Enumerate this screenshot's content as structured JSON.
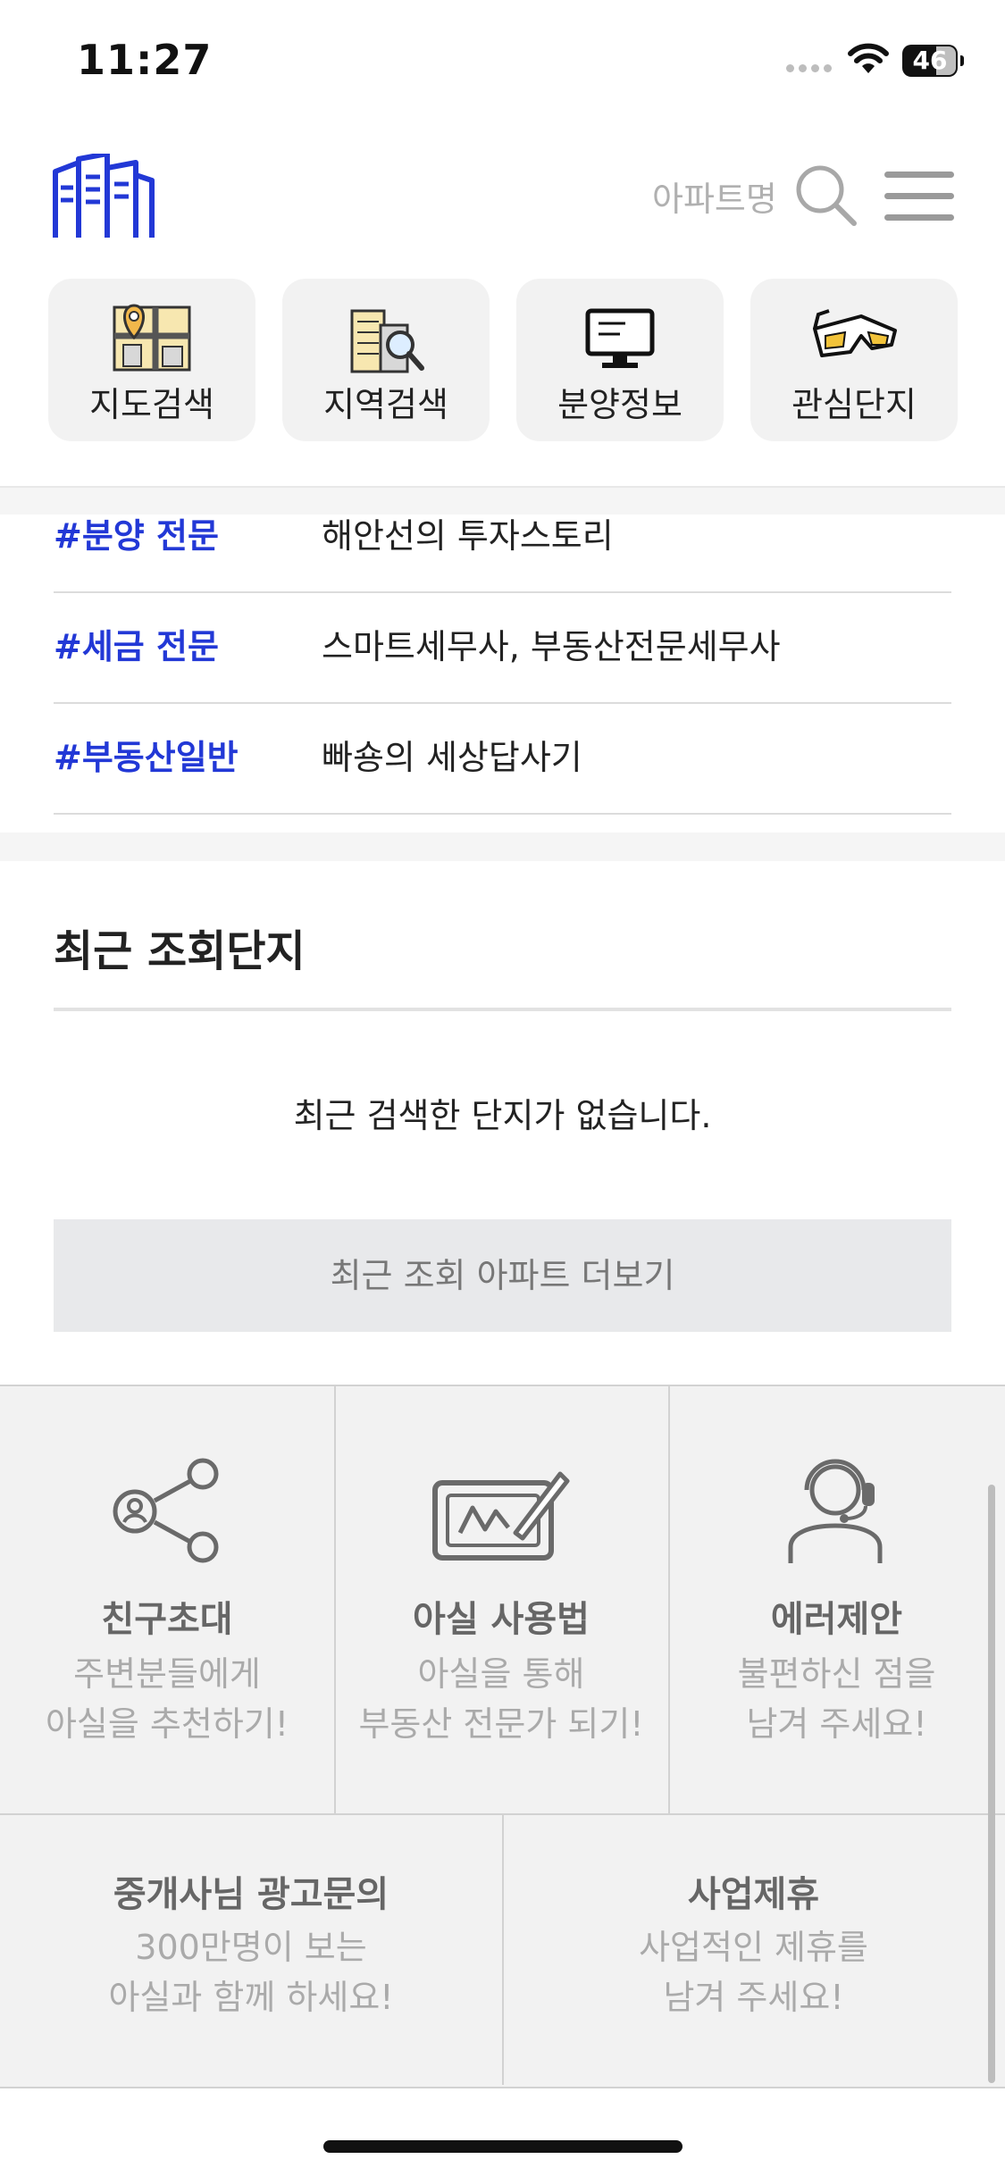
{
  "status": {
    "time": "11:27",
    "battery": "46"
  },
  "header": {
    "search_placeholder": "아파트명"
  },
  "quick_menu": [
    {
      "label": "지도검색",
      "icon": "map-search-icon"
    },
    {
      "label": "지역검색",
      "icon": "region-search-icon"
    },
    {
      "label": "분양정보",
      "icon": "monitor-icon"
    },
    {
      "label": "관심단지",
      "icon": "3d-glasses-icon"
    }
  ],
  "experts": [
    {
      "tag": "#분양 전문",
      "desc": "해안선의 투자스토리"
    },
    {
      "tag": "#세금 전문",
      "desc": "스마트세무사, 부동산전문세무사"
    },
    {
      "tag": "#부동산일반",
      "desc": "빠숑의 세상답사기"
    }
  ],
  "recent": {
    "title": "최근 조회단지",
    "empty_message": "최근 검색한 단지가 없습니다.",
    "more_button": "최근 조회 아파트 더보기"
  },
  "links": [
    {
      "title": "친구초대",
      "sub1": "주변분들에게",
      "sub2": "아실을 추천하기!",
      "icon": "share-icon"
    },
    {
      "title": "아실 사용법",
      "sub1": "아실을 통해",
      "sub2": "부동산 전문가 되기!",
      "icon": "signature-pad-icon"
    },
    {
      "title": "에러제안",
      "sub1": "불편하신 점을",
      "sub2": "남겨 주세요!",
      "icon": "headset-user-icon"
    },
    {
      "title": "중개사님 광고문의",
      "sub1": "300만명이 보는",
      "sub2": "아실과 함께 하세요!"
    },
    {
      "title": "사업제휴",
      "sub1": "사업적인 제휴를",
      "sub2": "남겨 주세요!"
    }
  ],
  "colors": {
    "accent": "#2238d6",
    "tile_bg": "#f2f2f2",
    "button_bg": "#e8e9eb"
  }
}
